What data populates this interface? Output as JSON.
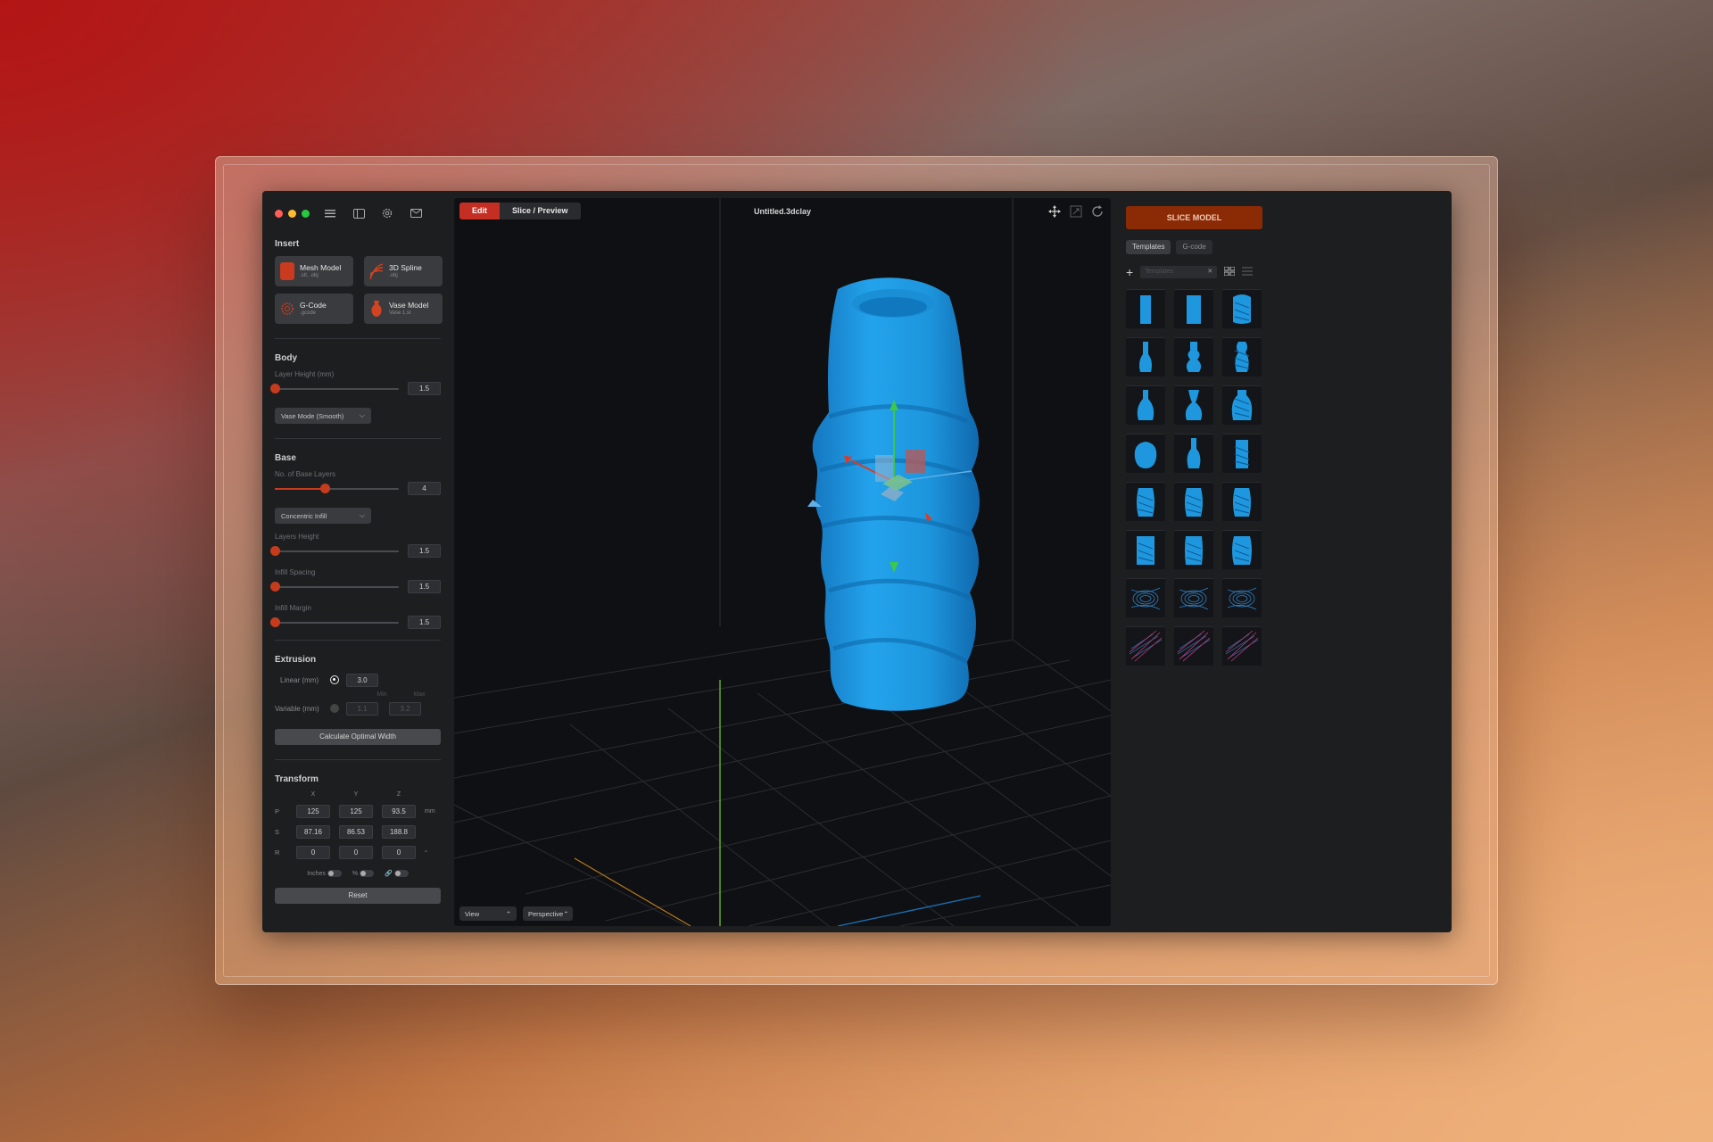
{
  "app": {
    "toolbar_icons": [
      "menu-icon",
      "sidebar-icon",
      "gear-icon",
      "mail-icon"
    ]
  },
  "insert": {
    "title": "Insert",
    "items": [
      {
        "name": "Mesh Model",
        "sub": ".stl, .obj"
      },
      {
        "name": "3D Spline",
        "sub": ".obj"
      },
      {
        "name": "G-Code",
        "sub": ".gcode"
      },
      {
        "name": "Vase Model",
        "sub": "Vase 1.st"
      }
    ]
  },
  "body": {
    "title": "Body",
    "layer_height_label": "Layer Height (mm)",
    "layer_height_value": "1.5",
    "mode_select": "Vase Mode (Smooth)"
  },
  "base": {
    "title": "Base",
    "base_layers_label": "No. of Base Layers",
    "base_layers_value": "4",
    "base_layers_fraction": 0.4,
    "infill_select": "Concentric Infill",
    "layers_height_label": "Layers Height",
    "layers_height_value": "1.5",
    "infill_spacing_label": "Infill Spacing",
    "infill_spacing_value": "1.5",
    "infill_margin_label": "Infill Margin",
    "infill_margin_value": "1.5"
  },
  "extrusion": {
    "title": "Extrusion",
    "linear_label": "Linear (mm)",
    "linear_value": "3.0",
    "min_label": "Min",
    "max_label": "Max",
    "variable_label": "Variable (mm)",
    "variable_min": "1.1",
    "variable_max": "3.2",
    "calc_button": "Calculate Optimal Width"
  },
  "transform": {
    "title": "Transform",
    "headers": [
      "X",
      "Y",
      "Z"
    ],
    "rows": [
      {
        "label": "P",
        "values": [
          "125",
          "125",
          "93.5"
        ],
        "unit": "mm"
      },
      {
        "label": "S",
        "values": [
          "87.16",
          "86.53",
          "188.8"
        ],
        "unit": ""
      },
      {
        "label": "R",
        "values": [
          "0",
          "0",
          "0"
        ],
        "unit": "°"
      }
    ],
    "toggles": [
      "Inches",
      "%",
      "🔗"
    ],
    "reset_button": "Reset"
  },
  "viewport": {
    "tab_edit": "Edit",
    "tab_slice": "Slice / Preview",
    "document_title": "Untitled.3dclay",
    "view_dropdown": "View",
    "projection_dropdown": "Perspective",
    "model_color": "#1e97de"
  },
  "sidebar_right": {
    "slice_button": "SLICE MODEL",
    "tab_templates": "Templates",
    "tab_gcode": "G-code",
    "search_placeholder": "Templates",
    "thumbnails": [
      "vase-ribbed-1",
      "vase-ribbed-2",
      "vase-twisted-1",
      "bottle-slim",
      "bottle-bulb",
      "bottle-tiered",
      "vase-flared-1",
      "vase-flared-2",
      "vase-flared-3",
      "sphere-vase",
      "vase-narrow",
      "vase-ridged",
      "vase-spiral-1",
      "vase-spiral-2",
      "vase-spiral-3",
      "vase-folded",
      "vase-fluted",
      "vase-wavy",
      "toolpath-1",
      "toolpath-2",
      "toolpath-3",
      "gcode-1",
      "gcode-2",
      "gcode-3"
    ]
  },
  "colors": {
    "accent": "#c73b1d",
    "slice_button": "#8a2b06",
    "tab_active": "#c52e22"
  }
}
